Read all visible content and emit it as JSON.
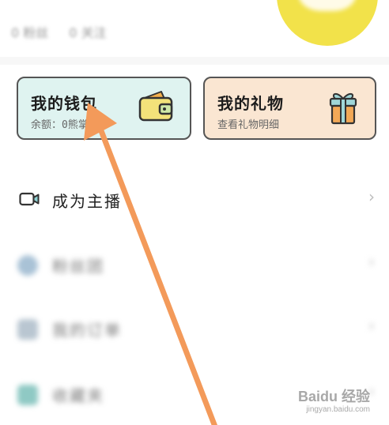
{
  "profile": {
    "stats": [
      {
        "value": "0",
        "label": "粉丝"
      },
      {
        "value": "0",
        "label": "关注"
      }
    ]
  },
  "cards": {
    "wallet": {
      "title": "我的钱包",
      "subtitle": "余额：0熊掌"
    },
    "gift": {
      "title": "我的礼物",
      "subtitle": "查看礼物明细"
    }
  },
  "menu": {
    "become_anchor": {
      "label": "成为主播",
      "chevron": "›"
    },
    "blurred_items": [
      {
        "label": "粉丝团",
        "chevron": "›"
      },
      {
        "label": "我的订单",
        "chevron": "›"
      },
      {
        "label": "收藏夹",
        "chevron": "›"
      }
    ]
  },
  "watermark": {
    "brand": "Baidu 经验",
    "url": "jingyan.baidu.com"
  },
  "colors": {
    "wallet_bg": "#dff3f0",
    "gift_bg": "#fae6d2",
    "annotation_arrow": "#f39a5a",
    "avatar": "#f2e24a"
  },
  "icons": {
    "wallet": "wallet-icon",
    "gift": "gift-box-icon",
    "anchor": "video-camera-icon",
    "chevron": "chevron-right-icon",
    "annotation": "annotation-arrow"
  }
}
